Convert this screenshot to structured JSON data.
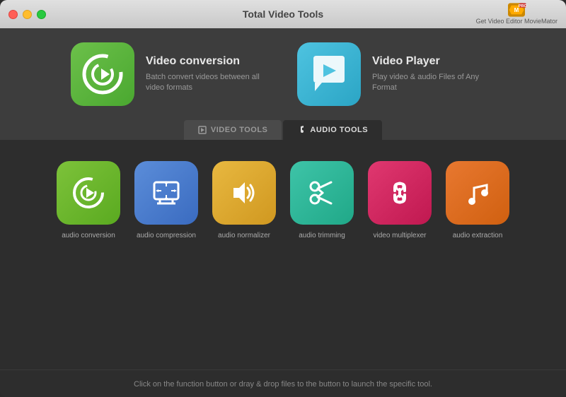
{
  "window": {
    "title": "Total Video Tools"
  },
  "branding": {
    "line1": "Get Video Editor MovieMator",
    "badge": "PRO"
  },
  "features": [
    {
      "id": "video-conversion",
      "title": "Video conversion",
      "description": "Batch convert videos between all video formats",
      "icon_color": "green"
    },
    {
      "id": "video-player",
      "title": "Video Player",
      "description": "Play video & audio Files of Any Format",
      "icon_color": "blue"
    }
  ],
  "tabs": [
    {
      "id": "video-tools",
      "label": "VIDEO TOOLS",
      "active": false
    },
    {
      "id": "audio-tools",
      "label": "AUDIO TOOLS",
      "active": true
    }
  ],
  "tools": [
    {
      "id": "audio-conversion",
      "label": "audio conversion",
      "color": "green"
    },
    {
      "id": "audio-compression",
      "label": "audio compression",
      "color": "blue"
    },
    {
      "id": "audio-normalizer",
      "label": "audio normalizer",
      "color": "yellow"
    },
    {
      "id": "audio-trimming",
      "label": "audio trimming",
      "color": "teal"
    },
    {
      "id": "video-multiplexer",
      "label": "video multiplexer",
      "color": "pink"
    },
    {
      "id": "audio-extraction",
      "label": "audio extraction",
      "color": "orange"
    }
  ],
  "footer": {
    "text": "Click on the function button or dray & drop files to the button to launch the specific tool."
  }
}
